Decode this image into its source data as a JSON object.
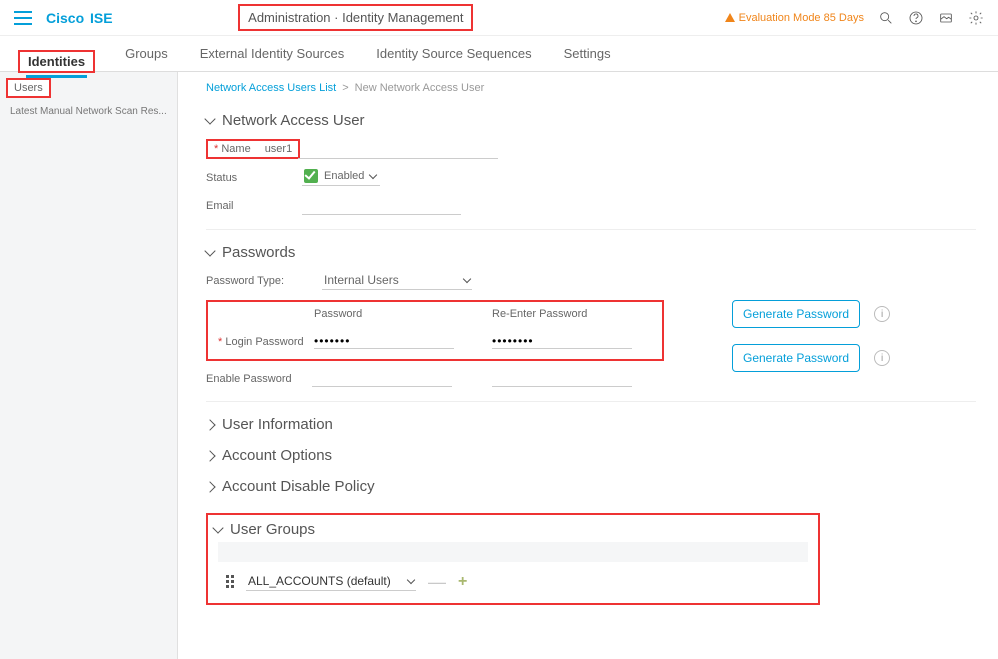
{
  "header": {
    "brand1": "Cisco",
    "brand2": "ISE",
    "crumb": "Administration · Identity Management",
    "eval": "Evaluation Mode 85 Days"
  },
  "tabs": [
    "Identities",
    "Groups",
    "External Identity Sources",
    "Identity Source Sequences",
    "Settings"
  ],
  "sidebar": {
    "selected": "Users",
    "item2": "Latest Manual Network Scan Res..."
  },
  "bc": {
    "link": "Network Access Users List",
    "sep": ">",
    "page": "New Network Access User"
  },
  "sec": {
    "nau": "Network Access User",
    "pw": "Passwords",
    "ui": "User Information",
    "ao": "Account Options",
    "adp": "Account Disable Policy",
    "ug": "User Groups"
  },
  "form": {
    "name_lbl": "Name",
    "name_val": "user1",
    "status_lbl": "Status",
    "status_val": "Enabled",
    "email_lbl": "Email",
    "email_val": "",
    "pwtype_lbl": "Password Type:",
    "pwtype_val": "Internal Users",
    "pw_col1": "Password",
    "pw_col2": "Re-Enter Password",
    "login_lbl": "Login Password",
    "login_val": "•••••••",
    "login_val2": "••••••••",
    "enable_lbl": "Enable Password",
    "gen": "Generate Password",
    "group_sel": "ALL_ACCOUNTS (default)"
  }
}
